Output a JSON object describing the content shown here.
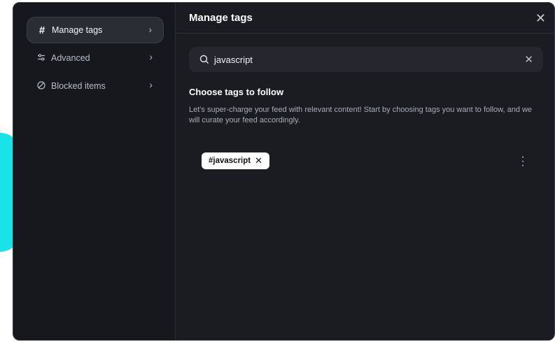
{
  "sidebar": {
    "items": [
      {
        "label": "Manage tags",
        "icon": "hash-icon",
        "active": true
      },
      {
        "label": "Advanced",
        "icon": "sliders-icon",
        "active": false
      },
      {
        "label": "Blocked items",
        "icon": "blocked-icon",
        "active": false
      }
    ]
  },
  "header": {
    "title": "Manage tags"
  },
  "search": {
    "value": "javascript"
  },
  "section": {
    "title": "Choose tags to follow",
    "description": "Let's super-charge your feed with relevant content! Start by choosing tags you want to follow, and we will curate your feed accordingly."
  },
  "tags": [
    {
      "label": "#javascript"
    }
  ],
  "colors": {
    "modal_bg": "#1b1c22",
    "sidebar_bg": "#17181d",
    "accent_shape": "#19e3e8",
    "chip_bg": "#ffffff"
  }
}
